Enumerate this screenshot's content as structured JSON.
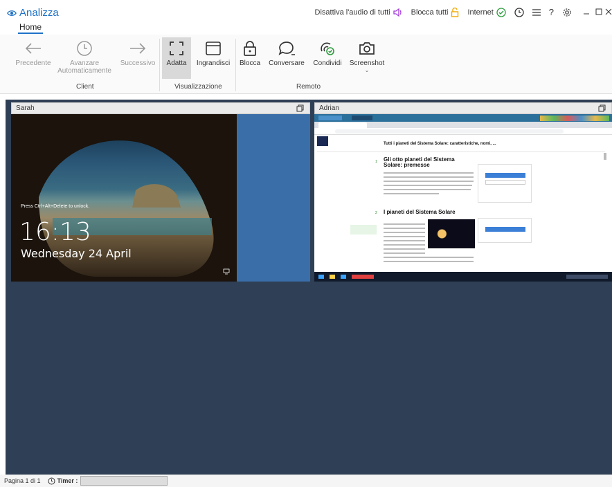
{
  "app": {
    "title": "Analizza"
  },
  "topbar": {
    "mute_all": "Disattiva l'audio di tutti",
    "lock_all": "Blocca tutti",
    "internet": "Internet",
    "help": "?"
  },
  "tabs": {
    "home": "Home"
  },
  "ribbon": {
    "previous": "Precedente",
    "auto_advance": "Avanzare Automaticamente",
    "next": "Successivo",
    "fit": "Adatta",
    "enlarge": "Ingrandisci",
    "lock": "Blocca",
    "chat": "Conversare",
    "share": "Condividi",
    "screenshot": "Screenshot",
    "group_client": "Client",
    "group_view": "Visualizzazione",
    "group_remote": "Remoto"
  },
  "panels": {
    "sarah": {
      "name": "Sarah",
      "hint": "Press Ctrl+Alt+Delete to unlock.",
      "time": "16:13",
      "date": "Wednesday 24 April"
    },
    "adrian": {
      "name": "Adrian",
      "page_title": "Tutti i pianeti del Sistema Solare: caratteristiche, nomi, ...",
      "section1_num": "1",
      "section1_title": "Gli otto pianeti del Sistema Solare: premesse",
      "section2_num": "2",
      "section2_title": "I pianeti del Sistema Solare"
    }
  },
  "footer": {
    "page": "Pagina 1 di 1",
    "timer": "Timer :"
  },
  "colors": {
    "accent": "#1f72c7",
    "main_bg": "#2f3f55",
    "desk_blue": "#3a6ea8"
  }
}
